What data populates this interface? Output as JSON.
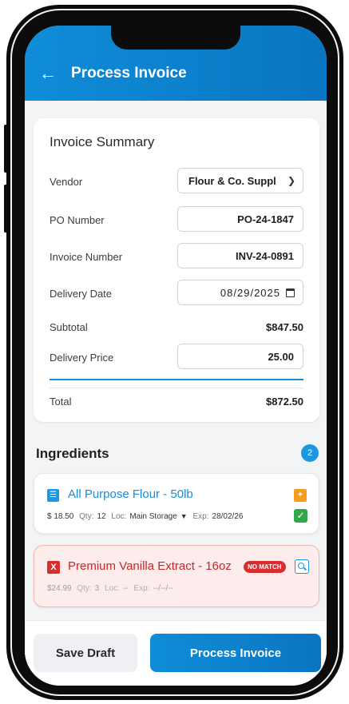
{
  "header": {
    "title": "Process Invoice",
    "back_icon": "arrow-left-icon"
  },
  "summary": {
    "title": "Invoice Summary",
    "vendor_label": "Vendor",
    "vendor_value": "Flour & Co. Suppl",
    "po_label": "PO Number",
    "po_value": "PO-24-1847",
    "invoice_label": "Invoice Number",
    "invoice_value": "INV-24-0891",
    "date_label": "Delivery Date",
    "date_value": "08/29/2025",
    "subtotal_label": "Subtotal",
    "subtotal_value": "$847.50",
    "delivery_label": "Delivery Price",
    "delivery_value": "25.00",
    "total_label": "Total",
    "total_value": "$872.50"
  },
  "ingredients": {
    "title": "Ingredients",
    "count": "2",
    "items": [
      {
        "name": "All Purpose Flour - 50lb",
        "price": "$ 18.50",
        "qty_label": "Qty:",
        "qty": "12",
        "loc_label": "Loc:",
        "loc": "Main Storage",
        "exp_label": "Exp:",
        "exp": "28/02/26",
        "status": "matched"
      },
      {
        "name": "Premium Vanilla Extract - 16oz",
        "badge": "NO MATCH",
        "price": "$24.99",
        "qty_label": "Qty:",
        "qty": "3",
        "loc_label": "Loc:",
        "loc": "--",
        "exp_label": "Exp:",
        "exp": "--/--/--",
        "status": "no-match"
      }
    ]
  },
  "footer": {
    "draft_label": "Save Draft",
    "process_label": "Process Invoice"
  },
  "colors": {
    "primary": "#0f8dd8",
    "danger": "#d92d2d",
    "success": "#2ea84a",
    "warning": "#f59c1a"
  }
}
